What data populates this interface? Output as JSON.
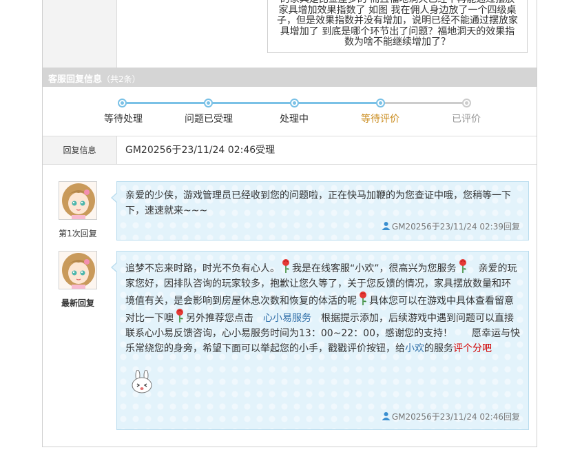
{
  "question": {
    "text": "的家具是比金屋多的 而且福地洞天已经不再能通过摆放家具增加效果指数了 如图 我在佣人身边放了一个四级桌子，但是效果指数并没有增加，说明已经不能通过摆放家具增加了 到底是哪个环节出了问题？福地洞天的效果指数为啥不能继续增加了？"
  },
  "section": {
    "title": "客服回复信息",
    "count": "（共2条）"
  },
  "progress": {
    "steps": [
      {
        "label": "等待处理",
        "state": "done"
      },
      {
        "label": "问题已受理",
        "state": "done"
      },
      {
        "label": "处理中",
        "state": "done"
      },
      {
        "label": "等待评价",
        "state": "current"
      },
      {
        "label": "已评价",
        "state": "pending"
      }
    ]
  },
  "reply_info": {
    "key": "回复信息",
    "value": "GM20256于23/11/24 02:46受理"
  },
  "replies": [
    {
      "avatar_label": "第1次回复",
      "text": "亲爱的少侠，游戏管理员已经收到您的问题啦，正在快马加鞭的为您查证中哦，您稍等一下下，速速就来~~~",
      "signature": "GM20256于23/11/24 02:39回复"
    },
    {
      "avatar_label": "最新回复",
      "p1": "追梦不忘来时路，时光不负有心人。",
      "p2": "我是在线客服“小欢”，很高兴为您服务",
      "p3": "亲爱的玩家您好，因排队咨询的玩家较多，抱歉让您久等了，关于您反馈的情况，家具摆放数量和环境值有关，是会影响到房屋休息次数和恢复的体活的呢",
      "p4": "具体您可以在游戏中具体查看留意对比一下噢",
      "p5": "另外推荐您点击",
      "link": "心小易服务",
      "p6": "根据提示添加，后续游戏中遇到问题可以直接联系心小易反馈咨询，心小易服务时间为13：00~22：00，感谢您的支持！　　愿幸运与快乐常绕您的身旁，希望下面可以举起您的小手，戳戳评价按钮，给",
      "p7": "小欢",
      "p8": "的服务",
      "p9": "评个分吧",
      "signature": "GM20256于23/11/24 02:46回复"
    }
  ],
  "icons": {
    "user": "user-icon",
    "rose": "rose-icon",
    "sticker": "rabbit-sticker-icon"
  },
  "colors": {
    "accent_blue": "#7ac1e6",
    "current_step": "#c98a1a",
    "link": "#2f6fa8",
    "highlight_red": "#d10000",
    "bubble_bg": "#e3f3fb"
  }
}
